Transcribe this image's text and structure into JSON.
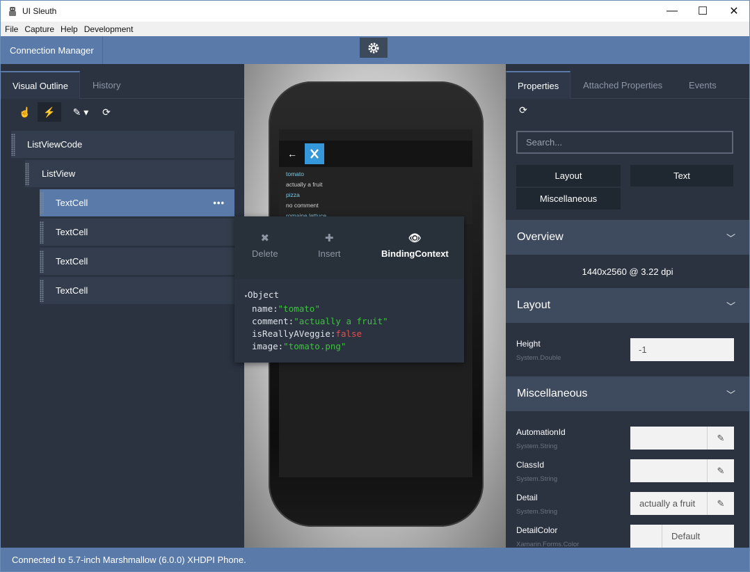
{
  "window": {
    "title": "UI Sleuth",
    "controls": {
      "minimize": "—",
      "maximize": "☐",
      "close": "✕"
    }
  },
  "menu": [
    "File",
    "Capture",
    "Help",
    "Development"
  ],
  "connection": {
    "label": "Connection Manager"
  },
  "left": {
    "tabs": [
      "Visual Outline",
      "History"
    ],
    "tree": [
      {
        "label": "ListViewCode",
        "selected": false
      },
      {
        "label": "ListView",
        "selected": false
      },
      {
        "label": "TextCell",
        "selected": true,
        "more": "•••"
      },
      {
        "label": "TextCell",
        "selected": false
      },
      {
        "label": "TextCell",
        "selected": false
      },
      {
        "label": "TextCell",
        "selected": false
      }
    ]
  },
  "phone": {
    "items": [
      "tomato",
      "actually a fruit",
      "pizza",
      "no comment",
      "romaine lettuce"
    ]
  },
  "popup": {
    "actions": {
      "delete": "Delete",
      "insert": "Insert",
      "binding": "BindingContext"
    },
    "object": "Object",
    "fields": [
      {
        "key": "name:",
        "value": "\"tomato\"",
        "kind": "s"
      },
      {
        "key": "comment:",
        "value": "\"actually a fruit\"",
        "kind": "s"
      },
      {
        "key": "isReallyAVeggie:",
        "value": "false",
        "kind": "b"
      },
      {
        "key": "image:",
        "value": "\"tomato.png\"",
        "kind": "s"
      }
    ]
  },
  "right": {
    "tabs": [
      "Properties",
      "Attached Properties",
      "Events"
    ],
    "search_placeholder": "Search...",
    "categories": [
      "Layout",
      "Text",
      "Miscellaneous"
    ],
    "sections": {
      "overview": "Overview",
      "layout": "Layout",
      "misc": "Miscellaneous"
    },
    "overview_value": "1440x2560 @ 3.22 dpi",
    "height": {
      "label": "Height",
      "type": "System.Double",
      "value": "-1"
    },
    "props": [
      {
        "label": "AutomationId",
        "type": "System.String",
        "value": ""
      },
      {
        "label": "ClassId",
        "type": "System.String",
        "value": ""
      },
      {
        "label": "Detail",
        "type": "System.String",
        "value": "actually a fruit"
      },
      {
        "label": "DetailColor",
        "type": "Xamarin.Forms.Color",
        "value": "Default"
      }
    ]
  },
  "status": "Connected to 5.7-inch Marshmallow (6.0.0) XHDPI Phone."
}
